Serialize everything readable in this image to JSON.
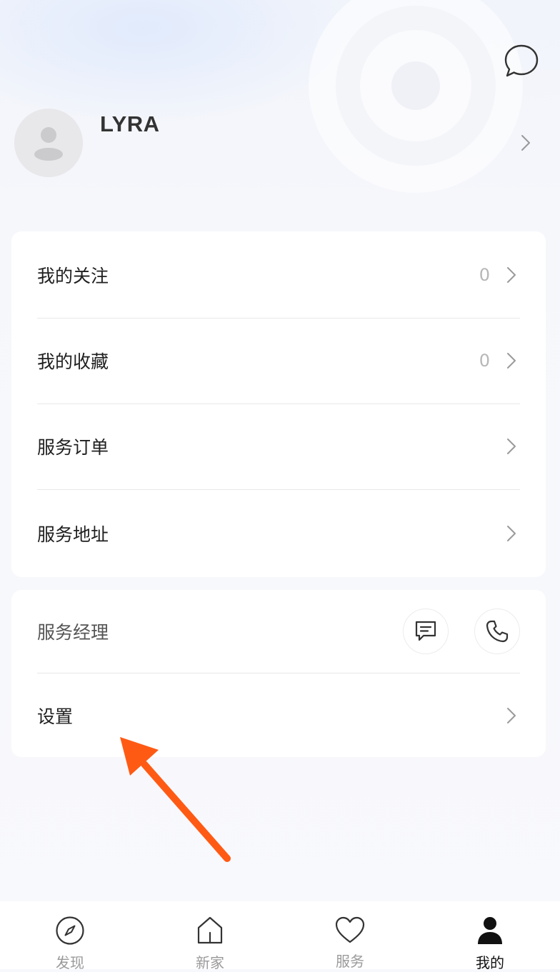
{
  "profile": {
    "username": "LYRA"
  },
  "menu_main": [
    {
      "label": "我的关注",
      "count": "0"
    },
    {
      "label": "我的收藏",
      "count": "0"
    },
    {
      "label": "服务订单"
    },
    {
      "label": "服务地址"
    }
  ],
  "menu_secondary": {
    "service_manager_label": "服务经理",
    "settings_label": "设置"
  },
  "tabbar": [
    {
      "label": "发现",
      "icon": "compass-icon",
      "active": false
    },
    {
      "label": "新家",
      "icon": "home-icon",
      "active": false
    },
    {
      "label": "服务",
      "icon": "heart-icon",
      "active": false
    },
    {
      "label": "我的",
      "icon": "user-icon",
      "active": true
    }
  ],
  "colors": {
    "annotation_arrow": "#ff5a14",
    "active_tab": "#111111",
    "inactive_tab": "#9a9a9c"
  }
}
